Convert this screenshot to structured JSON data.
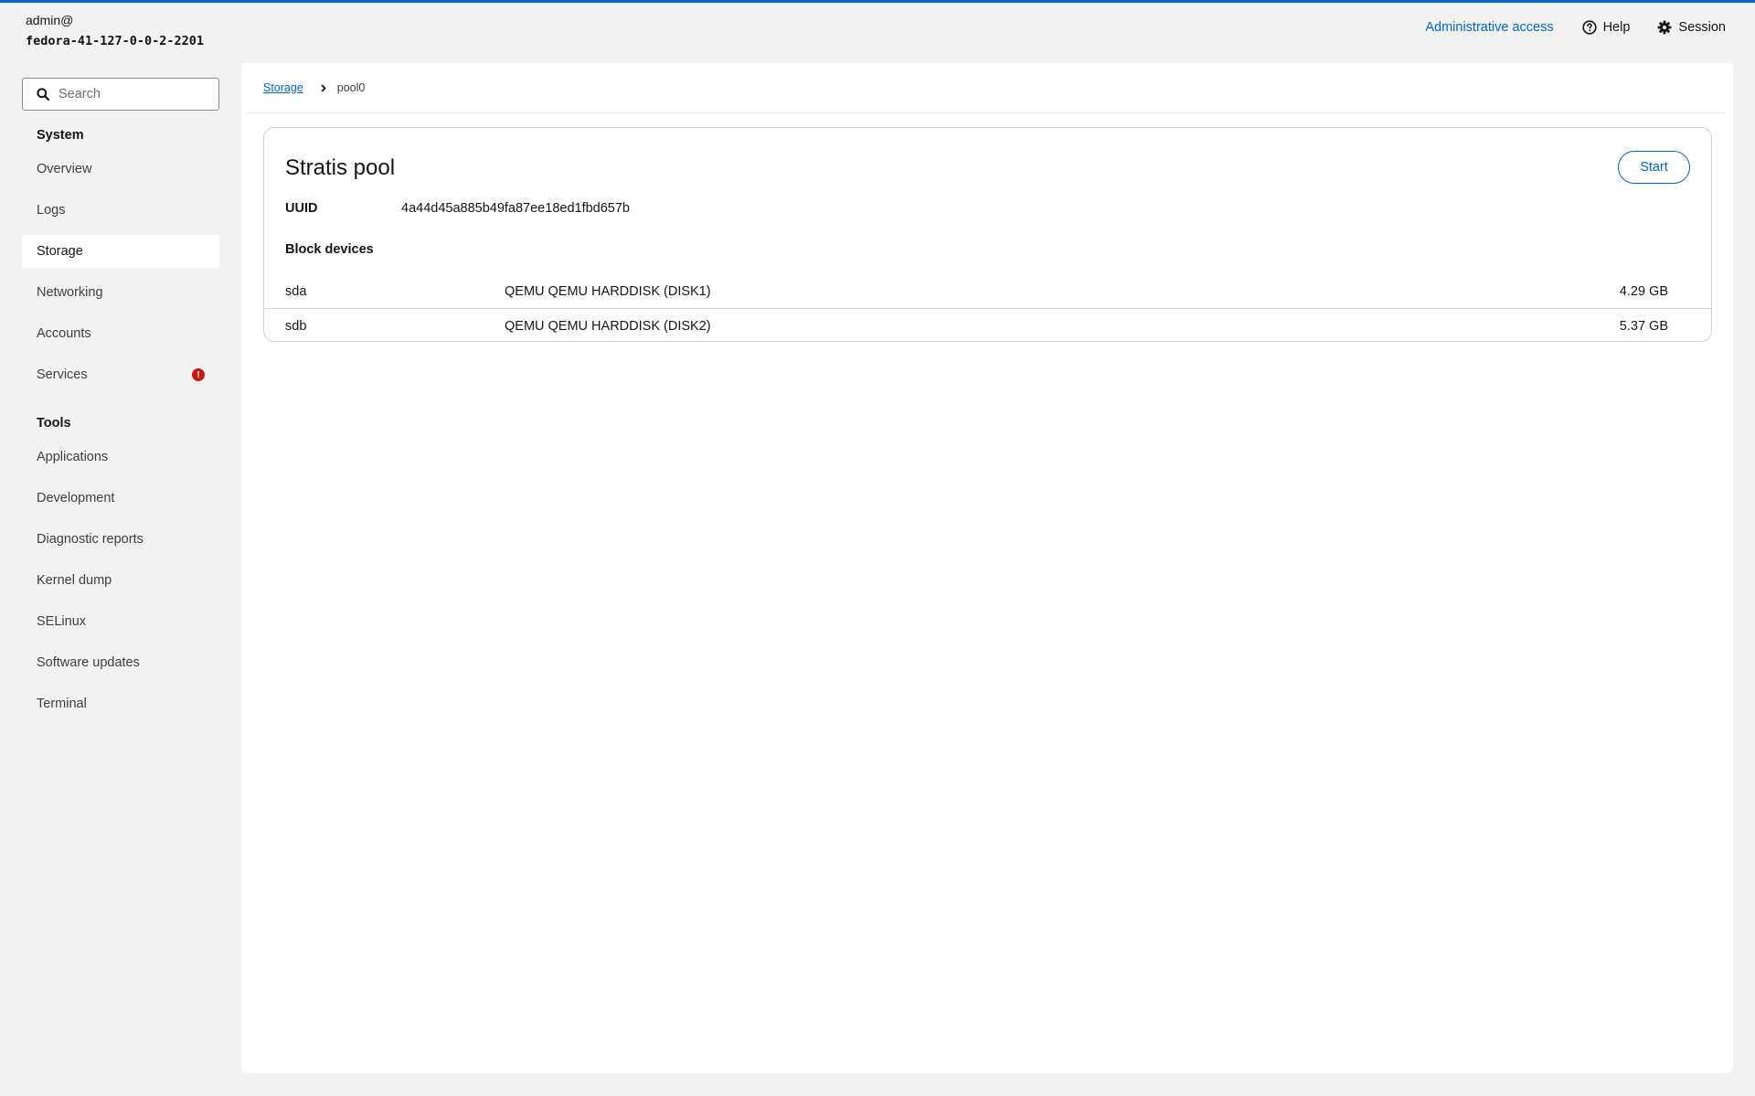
{
  "header": {
    "user": "admin@",
    "hostname": "fedora-41-127-0-0-2-2201",
    "admin_access": "Administrative access",
    "help": "Help",
    "session": "Session"
  },
  "search": {
    "placeholder": "Search"
  },
  "sidebar": {
    "system_heading": "System",
    "system_items": [
      {
        "label": "Overview"
      },
      {
        "label": "Logs"
      },
      {
        "label": "Storage",
        "active": true
      },
      {
        "label": "Networking"
      },
      {
        "label": "Accounts"
      },
      {
        "label": "Services",
        "badge": "!"
      }
    ],
    "tools_heading": "Tools",
    "tools_items": [
      {
        "label": "Applications"
      },
      {
        "label": "Development"
      },
      {
        "label": "Diagnostic reports"
      },
      {
        "label": "Kernel dump"
      },
      {
        "label": "SELinux"
      },
      {
        "label": "Software updates"
      },
      {
        "label": "Terminal"
      }
    ]
  },
  "breadcrumb": {
    "parent": "Storage",
    "current": "pool0"
  },
  "pool": {
    "title": "Stratis pool",
    "start_label": "Start",
    "uuid_label": "UUID",
    "uuid_value": "4a44d45a885b49fa87ee18ed1fbd657b",
    "block_devices_heading": "Block devices",
    "devices": [
      {
        "name": "sda",
        "model": "QEMU QEMU HARDDISK (DISK1)",
        "size": "4.29 GB"
      },
      {
        "name": "sdb",
        "model": "QEMU QEMU HARDDISK (DISK2)",
        "size": "5.37 GB"
      }
    ]
  },
  "colors": {
    "accent": "#0066cc",
    "danger": "#c9190b",
    "background": "#f2f2f2"
  },
  "icons": {
    "help": "help-circle-icon",
    "session": "gear-icon",
    "search": "search-icon",
    "breadcrumb_sep": "chevron-right-icon"
  }
}
